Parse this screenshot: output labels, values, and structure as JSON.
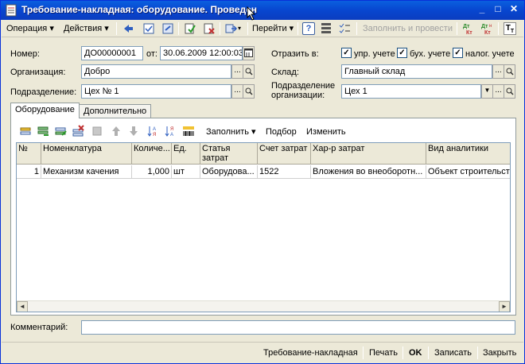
{
  "window": {
    "title": "Требование-накладная: оборудование. Проведен",
    "controls": [
      "_",
      "□",
      "✕"
    ]
  },
  "toolbar": {
    "operation": "Операция ▾",
    "actions": "Действия ▾",
    "goto": "Перейти ▾",
    "help": "?",
    "fill_and_post": "Заполнить и провести"
  },
  "form": {
    "number_label": "Номер:",
    "number_value": "ДО00000001",
    "date_label": "от:",
    "date_value": "30.06.2009 12:00:03",
    "org_label": "Организация:",
    "org_value": "Добро",
    "dept_label": "Подразделение:",
    "dept_value": "Цех № 1",
    "reflect_label": "Отразить в:",
    "reflect": {
      "mgmt": "упр. учете",
      "acct": "бух. учете",
      "tax": "налог. учете"
    },
    "warehouse_label": "Склад:",
    "warehouse_value": "Главный склад",
    "org_dept_label_1": "Подразделение",
    "org_dept_label_2": "организации:",
    "org_dept_value": "Цех 1"
  },
  "tabs": [
    "Оборудование",
    "Дополнительно"
  ],
  "grid_toolbar": {
    "fill": "Заполнить ▾",
    "select": "Подбор",
    "change": "Изменить"
  },
  "grid": {
    "headers": [
      "№",
      "Номенклатура",
      "Количе...",
      "Ед.",
      "Статья затрат",
      "Счет затрат",
      "Хар-р затрат",
      "Вид аналитики"
    ],
    "rows": [
      [
        "1",
        "Механизм качения",
        "1,000",
        "шт",
        "Оборудова...",
        "1522",
        "Вложения во внеоборотн...",
        "Объект строительст"
      ]
    ]
  },
  "comment_label": "Комментарий:",
  "comment_value": "",
  "bottom": {
    "print_form": "Требование-накладная",
    "print": "Печать",
    "ok": "OK",
    "save": "Записать",
    "close": "Закрыть"
  }
}
